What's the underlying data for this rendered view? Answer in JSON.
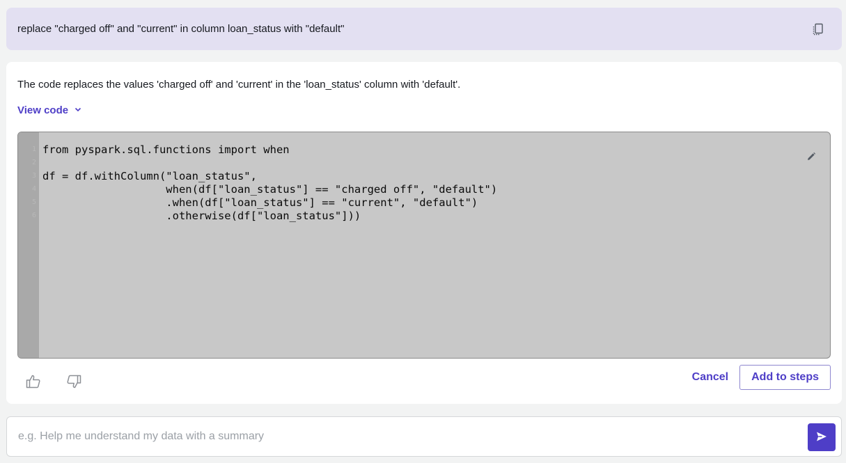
{
  "prompt": {
    "text": "replace \"charged off\" and \"current\" in column loan_status with \"default\""
  },
  "response": {
    "summary": "The code replaces the values 'charged off' and 'current' in the 'loan_status' column with 'default'.",
    "view_code_label": "View code",
    "code": {
      "lines": [
        "from pyspark.sql.functions import when",
        "",
        "df = df.withColumn(\"loan_status\",",
        "                   when(df[\"loan_status\"] == \"charged off\", \"default\")",
        "                   .when(df[\"loan_status\"] == \"current\", \"default\")",
        "                   .otherwise(df[\"loan_status\"]))"
      ]
    },
    "cancel_label": "Cancel",
    "add_label": "Add to steps"
  },
  "chat": {
    "placeholder": "e.g. Help me understand my data with a summary"
  },
  "icons": {
    "copy": "copy-icon",
    "edit": "pencil-icon",
    "thumbs_up": "thumbs-up-icon",
    "thumbs_down": "thumbs-down-icon",
    "expand": "chevron-down-icon",
    "send": "send-icon"
  },
  "colors": {
    "accent": "#4e3ec7",
    "prompt_bg": "#e3e0f2",
    "code_bg": "#c8c8c8"
  }
}
